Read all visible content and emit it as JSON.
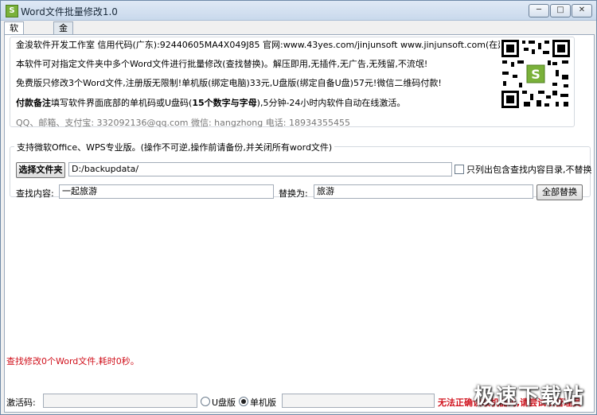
{
  "window": {
    "title": "Word文件批量修改1.0",
    "icon_letter": "S",
    "minimize_glyph": "─",
    "restore_glyph": "□",
    "close_glyph": "✕"
  },
  "tabs": [
    {
      "label": "软件设置",
      "active": true
    },
    {
      "label": "金浚软件",
      "active": false
    }
  ],
  "info": {
    "line1": "金浚软件开发工作室 信用代码(广东):92440605MA4X049J85 官网:www.43yes.com/jinjunsoft  www.jinjunsoft.com(在建)",
    "line2": "本软件可对指定文件夹中多个Word文件进行批量修改(查找替换)。解压即用,无插件,无广告,无残留,不流氓!",
    "line3": "免费版只修改3个Word文件,注册版无限制!单机版(绑定电脑)33元,U盘版(绑定自备U盘)57元!微信二维码付款!",
    "line4_bold": "付款备注",
    "line4_rest": "填写软件界面底部的单机码或U盘码(",
    "line4_bold2": "15个数字与字母",
    "line4_end": "),5分钟-24小时内软件自动在线激活。",
    "contact": "QQ、邮箱、支付宝: 332092136@qq.com    微信: hangzhong    电话: 18934355455"
  },
  "group": {
    "title": "支持微软Office、WPS专业版。(操作不可逆,操作前请备份,并关闭所有word文件)",
    "select_folder_label": "选择文件夹",
    "folder_path": "D:/backupdata/",
    "only_list_label": "只列出包含查找内容目录,不替换",
    "find_label": "查找内容:",
    "find_value": "一起旅游",
    "replace_label": "替换为:",
    "replace_value": "旅游",
    "replace_all_label": "全部替换"
  },
  "status": {
    "result_text": "查找修改0个Word文件,耗时0秒。"
  },
  "footer": {
    "activation_label": "激活码:",
    "activation_value": "",
    "usb_label": "U盘版",
    "machine_label": "单机版",
    "code_value": "",
    "warning_text": "无法正确读取机器码,请尝试以管理员",
    "selected": "machine"
  },
  "watermark": "极速下载站",
  "colors": {
    "accent_red": "#d0101b",
    "title_gradient_top": "#dfe9f5"
  }
}
